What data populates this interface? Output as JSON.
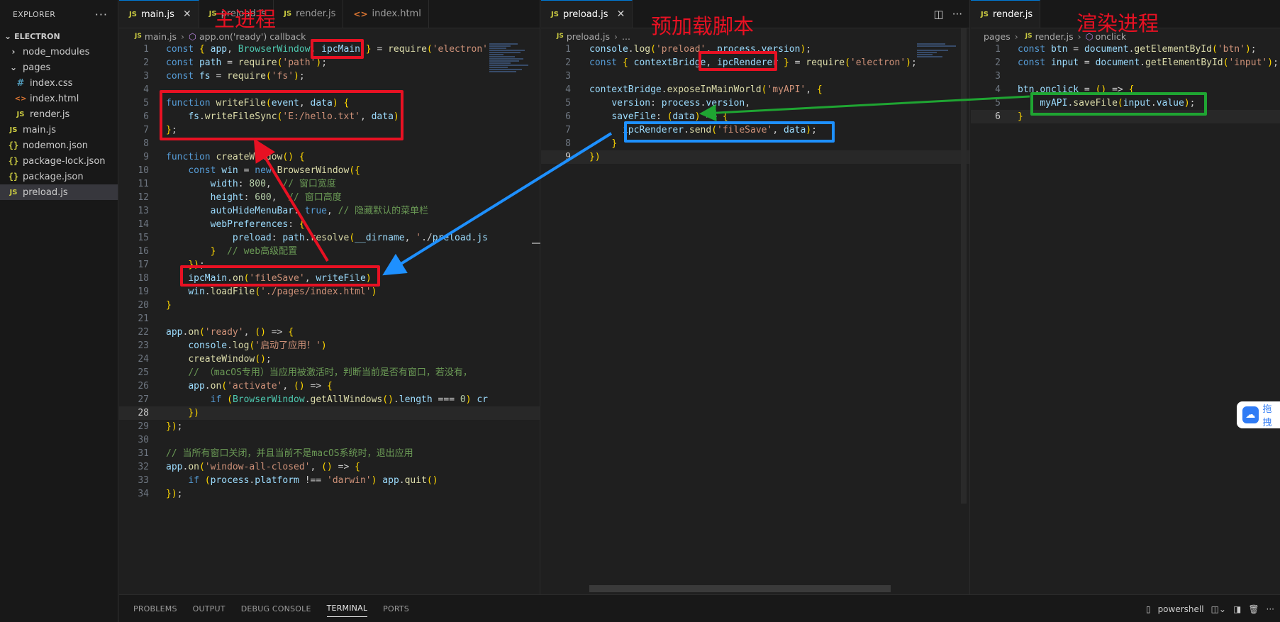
{
  "sidebar": {
    "title": "EXPLORER",
    "more": "···",
    "root": "ELECTRON",
    "items": [
      {
        "label": "node_modules",
        "icon": "chevron-right-icon",
        "indent": 1
      },
      {
        "label": "pages",
        "icon": "chevron-down-icon",
        "indent": 1
      },
      {
        "label": "index.css",
        "icon": "css-file-icon",
        "indent": 2
      },
      {
        "label": "index.html",
        "icon": "html-file-icon",
        "indent": 2
      },
      {
        "label": "render.js",
        "icon": "js-file-icon",
        "indent": 2
      },
      {
        "label": "main.js",
        "icon": "js-file-icon",
        "indent": 1
      },
      {
        "label": "nodemon.json",
        "icon": "json-file-icon",
        "indent": 1
      },
      {
        "label": "package-lock.json",
        "icon": "json-file-icon",
        "indent": 1
      },
      {
        "label": "package.json",
        "icon": "json-file-icon",
        "indent": 1
      },
      {
        "label": "preload.js",
        "icon": "js-file-icon",
        "indent": 1,
        "active": true
      }
    ]
  },
  "group1": {
    "tabs": [
      "main.js",
      "preload.js",
      "render.js",
      "index.html"
    ],
    "breadcrumb": [
      "main.js",
      "app.on('ready') callback"
    ],
    "current_line": "28",
    "lines": [
      {
        "n": "1",
        "t": "const { app, BrowserWindow, ipcMain } = require('electron'"
      },
      {
        "n": "2",
        "t": "const path = require('path');"
      },
      {
        "n": "3",
        "t": "const fs = require('fs');"
      },
      {
        "n": "4",
        "t": ""
      },
      {
        "n": "5",
        "t": "function writeFile(event, data) {"
      },
      {
        "n": "6",
        "t": "    fs.writeFileSync('E:/hello.txt', data);"
      },
      {
        "n": "7",
        "t": "};"
      },
      {
        "n": "8",
        "t": ""
      },
      {
        "n": "9",
        "t": "function createWindow() {"
      },
      {
        "n": "10",
        "t": "    const win = new BrowserWindow({"
      },
      {
        "n": "11",
        "t": "        width: 800,  // 窗口宽度"
      },
      {
        "n": "12",
        "t": "        height: 600,  // 窗口高度"
      },
      {
        "n": "13",
        "t": "        autoHideMenuBar: true, // 隐藏默认的菜单栏"
      },
      {
        "n": "14",
        "t": "        webPreferences: {"
      },
      {
        "n": "15",
        "t": "            preload: path.resolve(__dirname, './preload.js"
      },
      {
        "n": "16",
        "t": "        }  // web高级配置"
      },
      {
        "n": "17",
        "t": "    });"
      },
      {
        "n": "18",
        "t": "    ipcMain.on('fileSave', writeFile)"
      },
      {
        "n": "19",
        "t": "    win.loadFile('./pages/index.html')"
      },
      {
        "n": "20",
        "t": "}"
      },
      {
        "n": "21",
        "t": ""
      },
      {
        "n": "22",
        "t": "app.on('ready', () => {"
      },
      {
        "n": "23",
        "t": "    console.log('启动了应用！')"
      },
      {
        "n": "24",
        "t": "    createWindow();"
      },
      {
        "n": "25",
        "t": "    // （macOS专用）当应用被激活时，判断当前是否有窗口，若没有，"
      },
      {
        "n": "26",
        "t": "    app.on('activate', () => {"
      },
      {
        "n": "27",
        "t": "        if (BrowserWindow.getAllWindows().length === 0) cr"
      },
      {
        "n": "28",
        "t": "    })"
      },
      {
        "n": "29",
        "t": "});"
      },
      {
        "n": "30",
        "t": ""
      },
      {
        "n": "31",
        "t": "// 当所有窗口关闭，并且当前不是macOS系统时，退出应用"
      },
      {
        "n": "32",
        "t": "app.on('window-all-closed', () => {"
      },
      {
        "n": "33",
        "t": "    if (process.platform !== 'darwin') app.quit()"
      },
      {
        "n": "34",
        "t": "});"
      }
    ]
  },
  "group2": {
    "tabs": [
      "preload.js"
    ],
    "breadcrumb": [
      "preload.js",
      "..."
    ],
    "current_line": "9",
    "lines": [
      {
        "n": "1",
        "t": "console.log('preload', process.version);"
      },
      {
        "n": "2",
        "t": "const { contextBridge, ipcRenderer } = require('electron');"
      },
      {
        "n": "3",
        "t": ""
      },
      {
        "n": "4",
        "t": "contextBridge.exposeInMainWorld('myAPI', {"
      },
      {
        "n": "5",
        "t": "    version: process.version,"
      },
      {
        "n": "6",
        "t": "    saveFile: (data) => {"
      },
      {
        "n": "7",
        "t": "      ipcRenderer.send('fileSave', data);"
      },
      {
        "n": "8",
        "t": "    }"
      },
      {
        "n": "9",
        "t": "})"
      }
    ]
  },
  "group3": {
    "tabs": [
      "render.js"
    ],
    "breadcrumb": [
      "pages",
      "render.js",
      "onclick"
    ],
    "current_line": "6",
    "lines": [
      {
        "n": "1",
        "t": "const btn = document.getElementById('btn');"
      },
      {
        "n": "2",
        "t": "const input = document.getElementById('input');"
      },
      {
        "n": "3",
        "t": ""
      },
      {
        "n": "4",
        "t": "btn.onclick = () => {"
      },
      {
        "n": "5",
        "t": "    myAPI.saveFile(input.value);"
      },
      {
        "n": "6",
        "t": "}"
      }
    ]
  },
  "annotations": {
    "main_process": "主进程",
    "preload_script": "预加载脚本",
    "render_process": "渲染进程"
  },
  "panel": {
    "tabs": [
      "PROBLEMS",
      "OUTPUT",
      "DEBUG CONSOLE",
      "TERMINAL",
      "PORTS"
    ],
    "active_tab": "TERMINAL",
    "shell": "powershell"
  },
  "widget": {
    "label": "拖拽"
  },
  "colors": {
    "annotation_red": "#e81123",
    "annotation_blue": "#1e90ff",
    "annotation_green": "#1fa532"
  }
}
